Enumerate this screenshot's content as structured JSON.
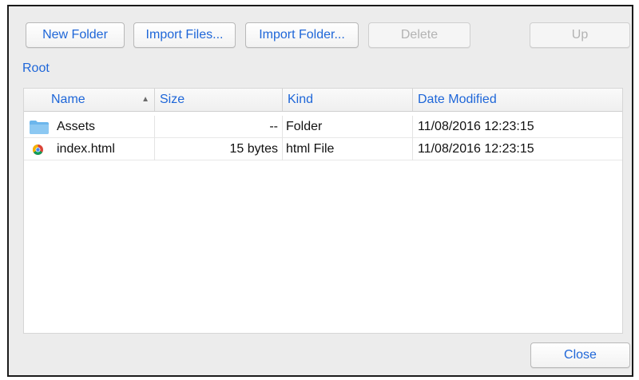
{
  "toolbar": {
    "new_folder": "New Folder",
    "import_files": "Import Files...",
    "import_folder": "Import Folder...",
    "delete": "Delete",
    "up": "Up"
  },
  "breadcrumb": {
    "root": "Root"
  },
  "table": {
    "columns": [
      "Name",
      "Size",
      "Kind",
      "Date Modified"
    ],
    "sort_indicator": "▲",
    "rows": [
      {
        "name": "Assets",
        "size": "--",
        "kind": "Folder",
        "date": "11/08/2016 12:23:15",
        "icon": "folder-icon"
      },
      {
        "name": "index.html",
        "size": "15 bytes",
        "kind": "html File",
        "date": "11/08/2016 12:23:15",
        "icon": "chrome-file-icon"
      }
    ]
  },
  "footer": {
    "close": "Close"
  },
  "colors": {
    "accent": "#1e66d8",
    "folder": "#6cb6ec",
    "disabled": "#b3b3b3"
  }
}
